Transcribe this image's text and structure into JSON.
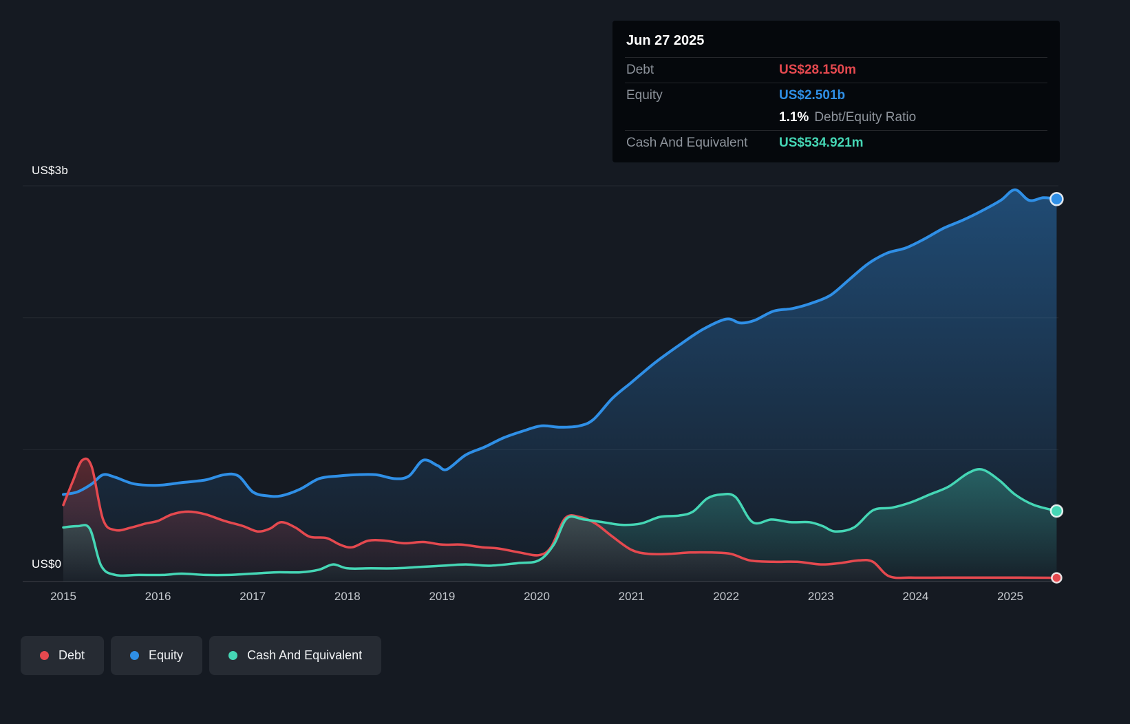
{
  "tooltip": {
    "date": "Jun 27 2025",
    "debt_label": "Debt",
    "debt_value": "US$28.150m",
    "equity_label": "Equity",
    "equity_value": "US$2.501b",
    "ratio_value": "1.1%",
    "ratio_label": "Debt/Equity Ratio",
    "cash_label": "Cash And Equivalent",
    "cash_value": "US$534.921m"
  },
  "y_axis": {
    "top_label": "US$3b",
    "bottom_label": "US$0"
  },
  "legend": {
    "items": [
      {
        "label": "Debt"
      },
      {
        "label": "Equity"
      },
      {
        "label": "Cash And Equivalent"
      }
    ]
  },
  "colors": {
    "background": "#151a22",
    "debt": "#e5494f",
    "equity": "#2f8fe6",
    "cash": "#45d6b5",
    "axis_text": "#c4c8cd",
    "gridline": "rgba(255,255,255,0.07)",
    "baseline": "rgba(255,255,255,0.18)",
    "tooltip_bg": "#05080c"
  },
  "chart_data": {
    "type": "area",
    "unit": "US$ billions",
    "x_ticks": [
      "2015",
      "2016",
      "2017",
      "2018",
      "2019",
      "2020",
      "2021",
      "2022",
      "2023",
      "2024",
      "2025"
    ],
    "x_range": [
      2015,
      2025.49
    ],
    "y_gridline_values": [
      3,
      2,
      1,
      0
    ],
    "y_axis_labels": [
      "US$3b",
      "US$0"
    ],
    "ylim": [
      0,
      3
    ],
    "legend_position": "bottom-left",
    "series": [
      {
        "name": "Debt",
        "key": "debt",
        "last_value_label": "US$28.150m",
        "points": [
          [
            2015.0,
            0.58
          ],
          [
            2015.1,
            0.76
          ],
          [
            2015.2,
            0.92
          ],
          [
            2015.3,
            0.87
          ],
          [
            2015.42,
            0.47
          ],
          [
            2015.55,
            0.39
          ],
          [
            2015.72,
            0.41
          ],
          [
            2015.87,
            0.44
          ],
          [
            2016.0,
            0.46
          ],
          [
            2016.15,
            0.51
          ],
          [
            2016.32,
            0.53
          ],
          [
            2016.5,
            0.51
          ],
          [
            2016.7,
            0.46
          ],
          [
            2016.9,
            0.42
          ],
          [
            2017.05,
            0.38
          ],
          [
            2017.18,
            0.4
          ],
          [
            2017.3,
            0.45
          ],
          [
            2017.45,
            0.41
          ],
          [
            2017.6,
            0.34
          ],
          [
            2017.78,
            0.33
          ],
          [
            2017.92,
            0.28
          ],
          [
            2018.05,
            0.26
          ],
          [
            2018.22,
            0.31
          ],
          [
            2018.4,
            0.31
          ],
          [
            2018.6,
            0.29
          ],
          [
            2018.8,
            0.3
          ],
          [
            2019.0,
            0.28
          ],
          [
            2019.2,
            0.28
          ],
          [
            2019.42,
            0.26
          ],
          [
            2019.6,
            0.25
          ],
          [
            2019.82,
            0.22
          ],
          [
            2020.02,
            0.2
          ],
          [
            2020.15,
            0.26
          ],
          [
            2020.3,
            0.48
          ],
          [
            2020.45,
            0.49
          ],
          [
            2020.62,
            0.44
          ],
          [
            2020.8,
            0.34
          ],
          [
            2021.0,
            0.24
          ],
          [
            2021.18,
            0.21
          ],
          [
            2021.4,
            0.21
          ],
          [
            2021.62,
            0.22
          ],
          [
            2021.85,
            0.22
          ],
          [
            2022.05,
            0.21
          ],
          [
            2022.25,
            0.16
          ],
          [
            2022.5,
            0.15
          ],
          [
            2022.75,
            0.15
          ],
          [
            2023.0,
            0.13
          ],
          [
            2023.2,
            0.14
          ],
          [
            2023.4,
            0.16
          ],
          [
            2023.55,
            0.15
          ],
          [
            2023.72,
            0.04
          ],
          [
            2023.95,
            0.03
          ],
          [
            2024.3,
            0.03
          ],
          [
            2024.7,
            0.03
          ],
          [
            2025.1,
            0.03
          ],
          [
            2025.49,
            0.028
          ]
        ]
      },
      {
        "name": "Equity",
        "key": "equity",
        "last_value_label": "US$2.501b",
        "points": [
          [
            2015.0,
            0.66
          ],
          [
            2015.15,
            0.68
          ],
          [
            2015.3,
            0.74
          ],
          [
            2015.42,
            0.81
          ],
          [
            2015.55,
            0.79
          ],
          [
            2015.75,
            0.74
          ],
          [
            2016.0,
            0.73
          ],
          [
            2016.25,
            0.75
          ],
          [
            2016.5,
            0.77
          ],
          [
            2016.7,
            0.81
          ],
          [
            2016.85,
            0.8
          ],
          [
            2017.0,
            0.68
          ],
          [
            2017.15,
            0.65
          ],
          [
            2017.3,
            0.65
          ],
          [
            2017.5,
            0.7
          ],
          [
            2017.7,
            0.78
          ],
          [
            2017.9,
            0.8
          ],
          [
            2018.1,
            0.81
          ],
          [
            2018.3,
            0.81
          ],
          [
            2018.5,
            0.78
          ],
          [
            2018.65,
            0.8
          ],
          [
            2018.8,
            0.92
          ],
          [
            2018.95,
            0.88
          ],
          [
            2019.05,
            0.85
          ],
          [
            2019.25,
            0.96
          ],
          [
            2019.45,
            1.02
          ],
          [
            2019.65,
            1.09
          ],
          [
            2019.85,
            1.14
          ],
          [
            2020.05,
            1.18
          ],
          [
            2020.25,
            1.17
          ],
          [
            2020.45,
            1.18
          ],
          [
            2020.6,
            1.23
          ],
          [
            2020.8,
            1.39
          ],
          [
            2021.0,
            1.51
          ],
          [
            2021.25,
            1.66
          ],
          [
            2021.5,
            1.79
          ],
          [
            2021.75,
            1.91
          ],
          [
            2022.0,
            1.99
          ],
          [
            2022.15,
            1.96
          ],
          [
            2022.3,
            1.98
          ],
          [
            2022.5,
            2.05
          ],
          [
            2022.7,
            2.07
          ],
          [
            2022.9,
            2.11
          ],
          [
            2023.1,
            2.17
          ],
          [
            2023.3,
            2.29
          ],
          [
            2023.5,
            2.41
          ],
          [
            2023.7,
            2.49
          ],
          [
            2023.9,
            2.53
          ],
          [
            2024.1,
            2.6
          ],
          [
            2024.3,
            2.68
          ],
          [
            2024.5,
            2.74
          ],
          [
            2024.7,
            2.81
          ],
          [
            2024.9,
            2.89
          ],
          [
            2025.05,
            2.97
          ],
          [
            2025.2,
            2.89
          ],
          [
            2025.35,
            2.91
          ],
          [
            2025.49,
            2.9
          ]
        ]
      },
      {
        "name": "Cash And Equivalent",
        "key": "cash",
        "last_value_label": "US$534.921m",
        "points": [
          [
            2015.0,
            0.41
          ],
          [
            2015.15,
            0.42
          ],
          [
            2015.28,
            0.4
          ],
          [
            2015.4,
            0.12
          ],
          [
            2015.55,
            0.05
          ],
          [
            2015.8,
            0.05
          ],
          [
            2016.05,
            0.05
          ],
          [
            2016.25,
            0.06
          ],
          [
            2016.5,
            0.05
          ],
          [
            2016.75,
            0.05
          ],
          [
            2017.0,
            0.06
          ],
          [
            2017.25,
            0.07
          ],
          [
            2017.5,
            0.07
          ],
          [
            2017.7,
            0.09
          ],
          [
            2017.85,
            0.13
          ],
          [
            2018.0,
            0.1
          ],
          [
            2018.25,
            0.1
          ],
          [
            2018.5,
            0.1
          ],
          [
            2018.75,
            0.11
          ],
          [
            2019.0,
            0.12
          ],
          [
            2019.25,
            0.13
          ],
          [
            2019.5,
            0.12
          ],
          [
            2019.8,
            0.14
          ],
          [
            2020.02,
            0.16
          ],
          [
            2020.18,
            0.28
          ],
          [
            2020.32,
            0.48
          ],
          [
            2020.5,
            0.47
          ],
          [
            2020.7,
            0.45
          ],
          [
            2020.9,
            0.43
          ],
          [
            2021.1,
            0.44
          ],
          [
            2021.3,
            0.49
          ],
          [
            2021.5,
            0.5
          ],
          [
            2021.65,
            0.53
          ],
          [
            2021.8,
            0.63
          ],
          [
            2021.95,
            0.66
          ],
          [
            2022.1,
            0.64
          ],
          [
            2022.28,
            0.45
          ],
          [
            2022.48,
            0.47
          ],
          [
            2022.68,
            0.45
          ],
          [
            2022.88,
            0.45
          ],
          [
            2023.02,
            0.42
          ],
          [
            2023.15,
            0.38
          ],
          [
            2023.35,
            0.41
          ],
          [
            2023.55,
            0.54
          ],
          [
            2023.75,
            0.56
          ],
          [
            2023.95,
            0.6
          ],
          [
            2024.15,
            0.66
          ],
          [
            2024.35,
            0.72
          ],
          [
            2024.55,
            0.82
          ],
          [
            2024.7,
            0.85
          ],
          [
            2024.88,
            0.77
          ],
          [
            2025.05,
            0.66
          ],
          [
            2025.25,
            0.58
          ],
          [
            2025.49,
            0.535
          ]
        ]
      }
    ]
  }
}
